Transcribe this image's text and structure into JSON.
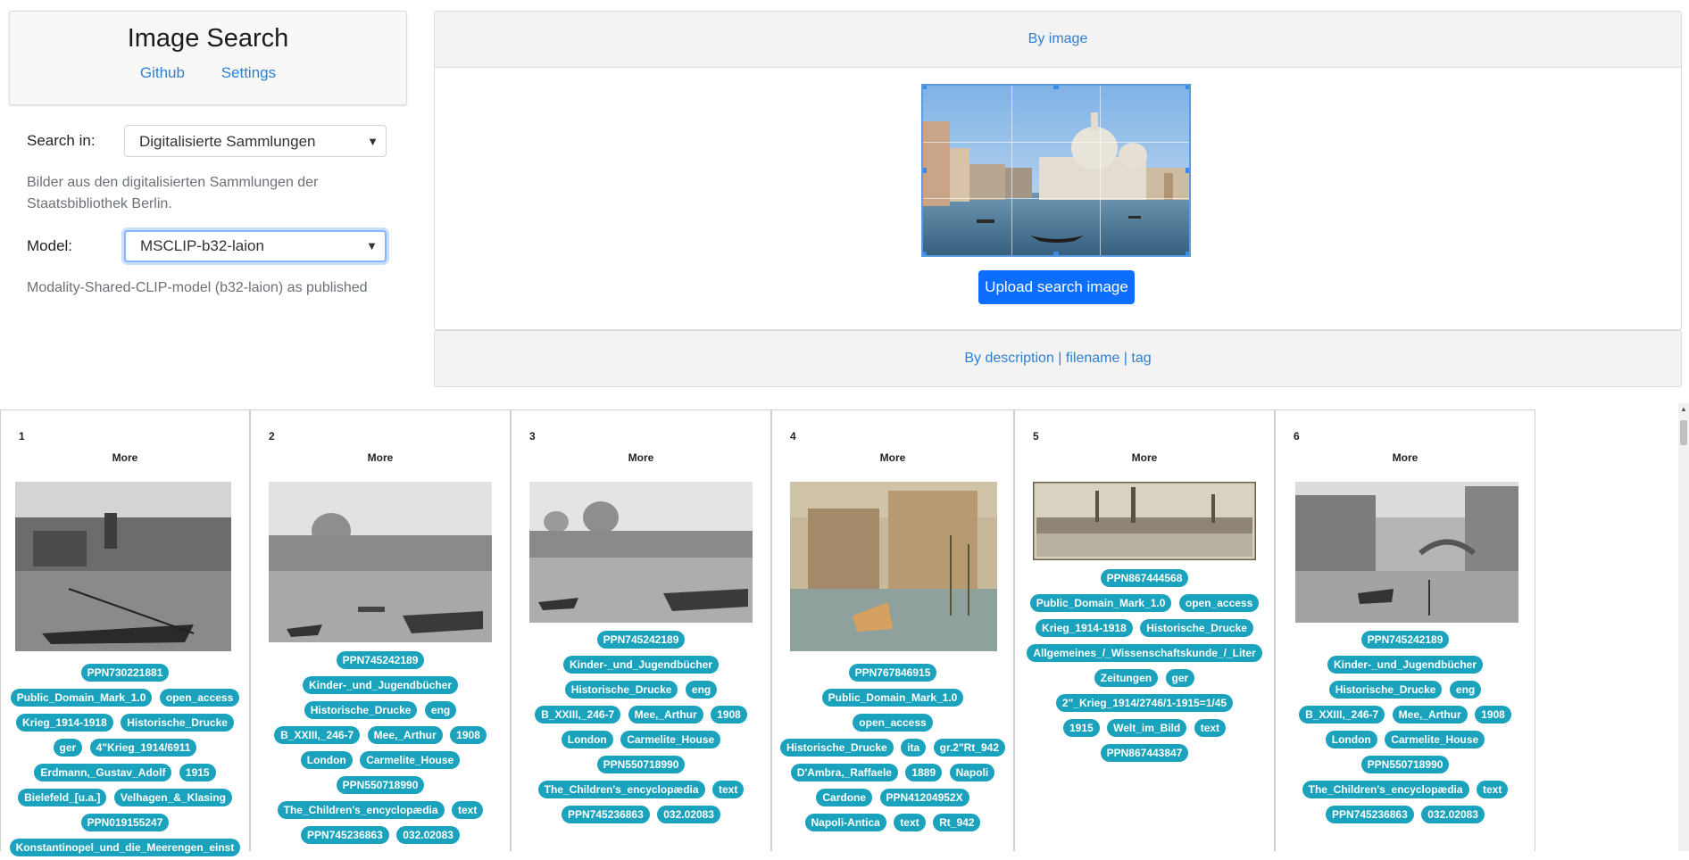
{
  "header": {
    "title": "Image Search",
    "links": [
      "Github",
      "Settings"
    ]
  },
  "form": {
    "search_in_label": "Search in:",
    "search_in_value": "Digitalisierte Sammlungen",
    "search_in_help": "Bilder aus den digitalisierten Sammlungen der Staatsbibliothek Berlin.",
    "model_label": "Model:",
    "model_value": "MSCLIP-b32-laion",
    "model_help": "Modality-Shared-CLIP-model (b32-laion) as published"
  },
  "search": {
    "by_image_label": "By image",
    "upload_button": "Upload search image",
    "by_description_label": "By description | filename | tag"
  },
  "results": [
    {
      "num": "1",
      "more": "More",
      "tags": [
        "PPN730221881",
        "Public_Domain_Mark_1.0",
        "open_access",
        "Krieg_1914-1918",
        "Historische_Drucke",
        "ger",
        "4\"Krieg_1914/6911",
        "Erdmann,_Gustav_Adolf",
        "1915",
        "Bielefeld_[u.a.]",
        "Velhagen_&_Klasing",
        "PPN019155247",
        "Konstantinopel_und_die_Meerengen_einst"
      ]
    },
    {
      "num": "2",
      "more": "More",
      "tags": [
        "PPN745242189",
        "Kinder-_und_Jugendbücher",
        "Historische_Drucke",
        "eng",
        "B_XXIII,_246-7",
        "Mee,_Arthur",
        "1908",
        "London",
        "Carmelite_House",
        "PPN550718990",
        "The_Children's_encyclopædia",
        "text",
        "PPN745236863",
        "032.02083"
      ]
    },
    {
      "num": "3",
      "more": "More",
      "tags": [
        "PPN745242189",
        "Kinder-_und_Jugendbücher",
        "Historische_Drucke",
        "eng",
        "B_XXIII,_246-7",
        "Mee,_Arthur",
        "1908",
        "London",
        "Carmelite_House",
        "PPN550718990",
        "The_Children's_encyclopædia",
        "text",
        "PPN745236863",
        "032.02083"
      ]
    },
    {
      "num": "4",
      "more": "More",
      "tags": [
        "PPN767846915",
        "Public_Domain_Mark_1.0",
        "open_access",
        "Historische_Drucke",
        "ita",
        "gr.2\"Rt_942",
        "D'Ambra,_Raffaele",
        "1889",
        "Napoli",
        "Cardone",
        "PPN41204952X",
        "Napoli-Antica",
        "text",
        "Rt_942"
      ]
    },
    {
      "num": "5",
      "more": "More",
      "tags": [
        "PPN867444568",
        "Public_Domain_Mark_1.0",
        "open_access",
        "Krieg_1914-1918",
        "Historische_Drucke",
        "Allgemeines_/_Wissenschaftskunde_/_Liter",
        "Zeitungen",
        "ger",
        "2\"_Krieg_1914/2746/1-1915=1/45",
        "1915",
        "Welt_im_Bild",
        "text",
        "PPN867443847"
      ]
    },
    {
      "num": "6",
      "more": "More",
      "tags": [
        "PPN745242189",
        "Kinder-_und_Jugendbücher",
        "Historische_Drucke",
        "eng",
        "B_XXIII,_246-7",
        "Mee,_Arthur",
        "1908",
        "London",
        "Carmelite_House",
        "PPN550718990",
        "The_Children's_encyclopædia",
        "text",
        "PPN745236863",
        "032.02083"
      ]
    }
  ],
  "colors": {
    "link": "#2f80d3",
    "primary_button": "#0d6efd",
    "tag_badge": "#1ba2bc"
  }
}
